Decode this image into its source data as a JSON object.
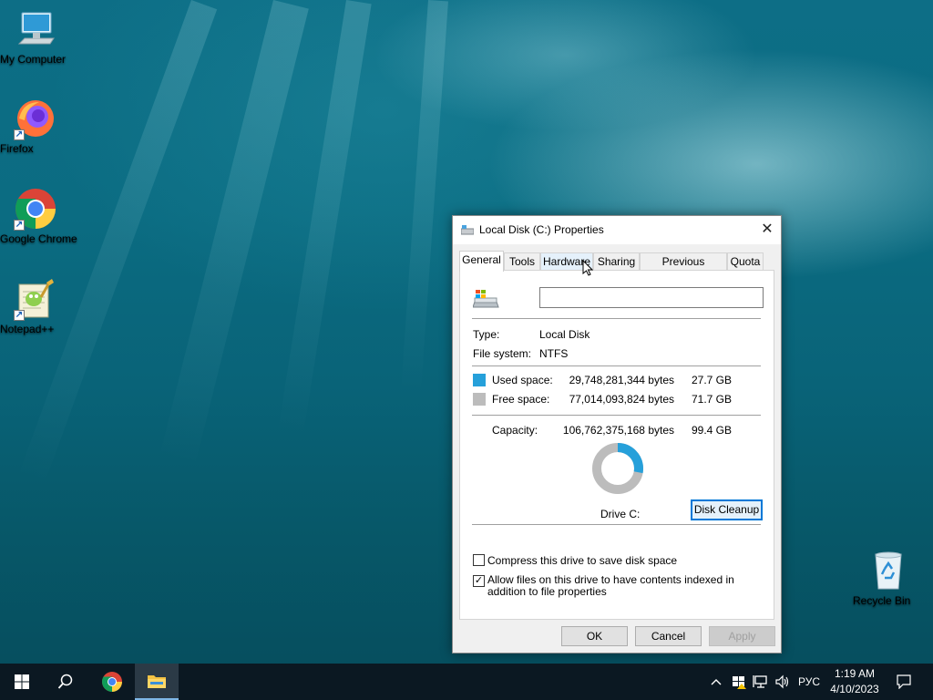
{
  "desktop": {
    "icons": [
      {
        "label": "My Computer",
        "icon": "computer-icon"
      },
      {
        "label": "Firefox",
        "icon": "firefox-icon"
      },
      {
        "label": "Google Chrome",
        "icon": "chrome-icon"
      },
      {
        "label": "Notepad++",
        "icon": "notepadpp-icon"
      },
      {
        "label": "Recycle Bin",
        "icon": "recycle-bin-icon"
      }
    ]
  },
  "dialog": {
    "title": "Local Disk (C:) Properties",
    "close_label": "✕",
    "tabs": [
      {
        "label": "General",
        "active": true
      },
      {
        "label": "Tools",
        "active": false
      },
      {
        "label": "Hardware",
        "active": false
      },
      {
        "label": "Sharing",
        "active": false
      },
      {
        "label": "Previous Versions",
        "active": false
      },
      {
        "label": "Quota",
        "active": false
      }
    ],
    "general": {
      "name_value": "",
      "type_label": "Type:",
      "type_value": "Local Disk",
      "fs_label": "File system:",
      "fs_value": "NTFS",
      "used_label": "Used space:",
      "used_bytes": "29,748,281,344 bytes",
      "used_gb": "27.7 GB",
      "free_label": "Free space:",
      "free_bytes": "77,014,093,824 bytes",
      "free_gb": "71.7 GB",
      "capacity_label": "Capacity:",
      "capacity_bytes": "106,762,375,168 bytes",
      "capacity_gb": "99.4 GB",
      "drive_label": "Drive C:",
      "disk_cleanup_label": "Disk Cleanup",
      "compress_label": "Compress this drive to save disk space",
      "compress_checked": false,
      "index_label": "Allow files on this drive to have contents indexed in addition to file properties",
      "index_checked": true,
      "used_fraction": 0.279,
      "used_color": "#26a0da",
      "free_color": "#bcbcbc"
    },
    "buttons": {
      "ok": "OK",
      "cancel": "Cancel",
      "apply": "Apply"
    }
  },
  "taskbar": {
    "language": "РУС",
    "time": "1:19 AM",
    "date": "4/10/2023"
  }
}
